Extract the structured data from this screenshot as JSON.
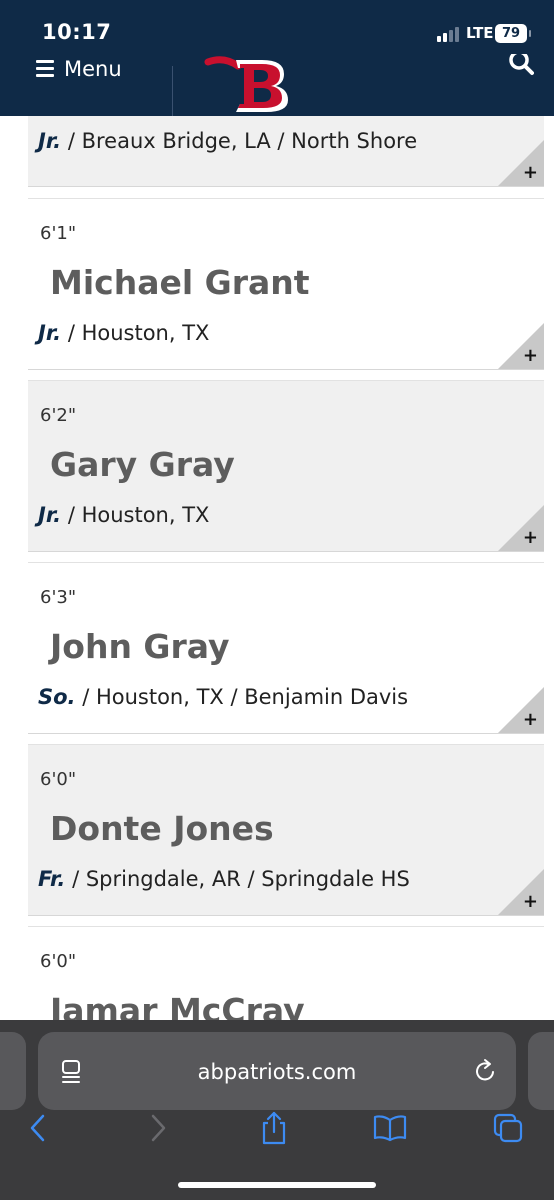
{
  "status_bar": {
    "time": "10:17",
    "network": "LTE",
    "battery": "79"
  },
  "header": {
    "menu_label": "Menu"
  },
  "players": [
    {
      "height": "",
      "name": "",
      "year": "Jr.",
      "details": " / Breaux Bridge, LA / North Shore"
    },
    {
      "height": "6'1\"",
      "name": "Michael Grant",
      "year": "Jr.",
      "details": " / Houston, TX"
    },
    {
      "height": "6'2\"",
      "name": "Gary Gray",
      "year": "Jr.",
      "details": " / Houston, TX"
    },
    {
      "height": "6'3\"",
      "name": "John Gray",
      "year": "So.",
      "details": " / Houston, TX / Benjamin Davis"
    },
    {
      "height": "6'0\"",
      "name": "Donte Jones",
      "year": "Fr.",
      "details": " / Springdale, AR / Springdale HS"
    },
    {
      "height": "6'0\"",
      "name": "Jamar McCray",
      "year": "",
      "details": ""
    }
  ],
  "expand_symbol": "+",
  "browser": {
    "url": "abpatriots.com"
  },
  "colors": {
    "navy": "#0f2a47",
    "logo_red": "#c8102e",
    "card_alt": "#f0f0f0",
    "toolbar": "#3b3b3d",
    "accent_blue": "#3d8bf2"
  }
}
